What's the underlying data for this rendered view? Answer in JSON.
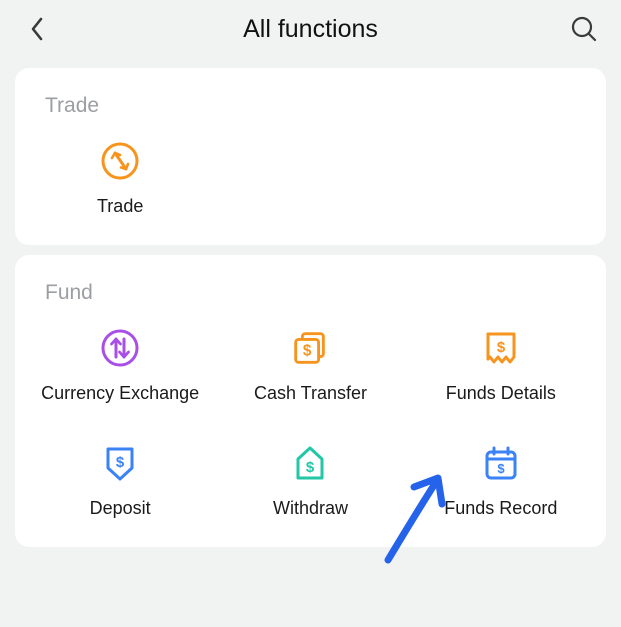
{
  "header": {
    "title": "All functions"
  },
  "sections": {
    "trade": {
      "title": "Trade",
      "items": {
        "trade": {
          "label": "Trade",
          "icon": "trade-icon"
        }
      }
    },
    "fund": {
      "title": "Fund",
      "items": {
        "currency_exchange": {
          "label": "Currency Exchange",
          "icon": "currency-exchange-icon"
        },
        "cash_transfer": {
          "label": "Cash Transfer",
          "icon": "cash-transfer-icon"
        },
        "funds_details": {
          "label": "Funds Details",
          "icon": "funds-details-icon"
        },
        "deposit": {
          "label": "Deposit",
          "icon": "deposit-icon"
        },
        "withdraw": {
          "label": "Withdraw",
          "icon": "withdraw-icon"
        },
        "funds_record": {
          "label": "Funds Record",
          "icon": "funds-record-icon"
        }
      }
    }
  },
  "colors": {
    "orange": "#f7941d",
    "purple": "#a94fe8",
    "teal": "#21c7a7",
    "blue": "#3b82f6",
    "arrow": "#2563eb"
  }
}
